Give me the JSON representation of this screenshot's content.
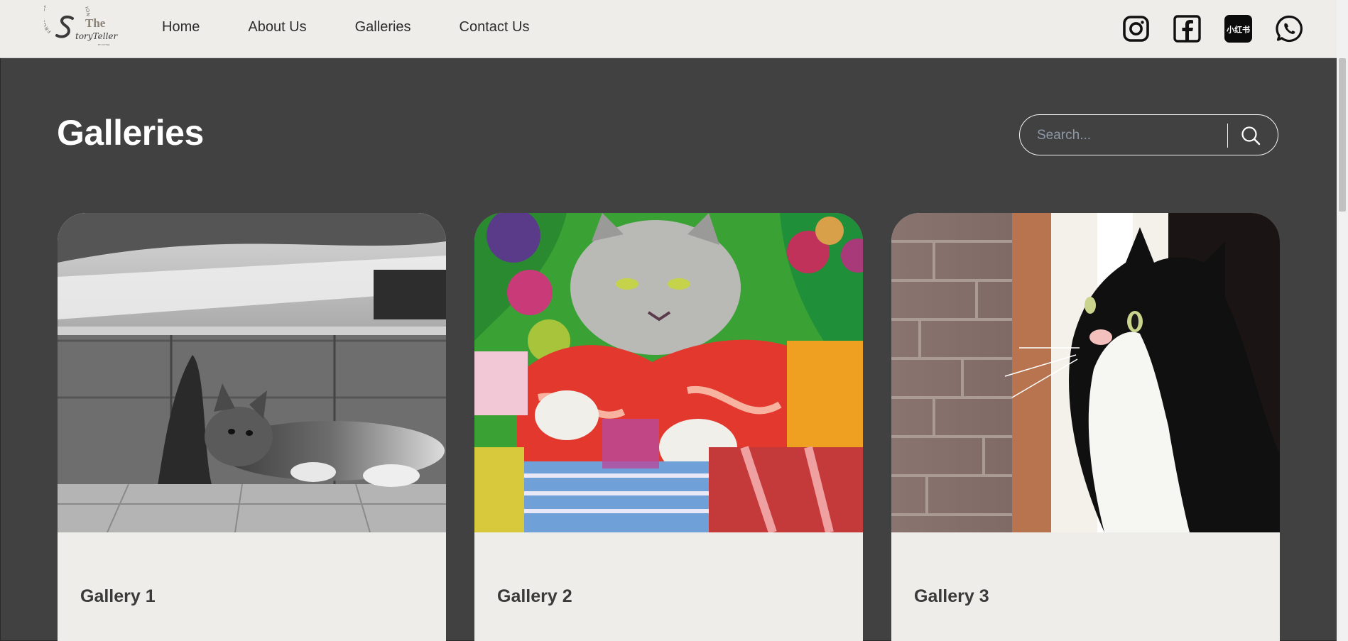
{
  "header": {
    "logo": {
      "alt": "The StoryTeller",
      "lettering": "The StoryTeller"
    },
    "nav": [
      {
        "label": "Home"
      },
      {
        "label": "About Us"
      },
      {
        "label": "Galleries"
      },
      {
        "label": "Contact Us"
      }
    ],
    "social": [
      {
        "icon": "instagram-icon"
      },
      {
        "icon": "facebook-icon"
      },
      {
        "icon": "xiaohongshu-icon",
        "text": "小红书"
      },
      {
        "icon": "whatsapp-icon"
      }
    ]
  },
  "main": {
    "title": "Galleries",
    "search": {
      "placeholder": "Search...",
      "value": ""
    }
  },
  "galleries": [
    {
      "title": "Gallery 1",
      "image": "black-and-white kitten resting beside a curb"
    },
    {
      "title": "Gallery 2",
      "image": "watercolor painting of a cat with Christmas ornaments and presents"
    },
    {
      "title": "Gallery 3",
      "image": "black and white cat looking out a window"
    }
  ],
  "colors": {
    "background": "#414141",
    "header": "#eeede9",
    "card": "#eeede9",
    "text_dark": "#2d2d2d",
    "title": "#ffffff"
  }
}
